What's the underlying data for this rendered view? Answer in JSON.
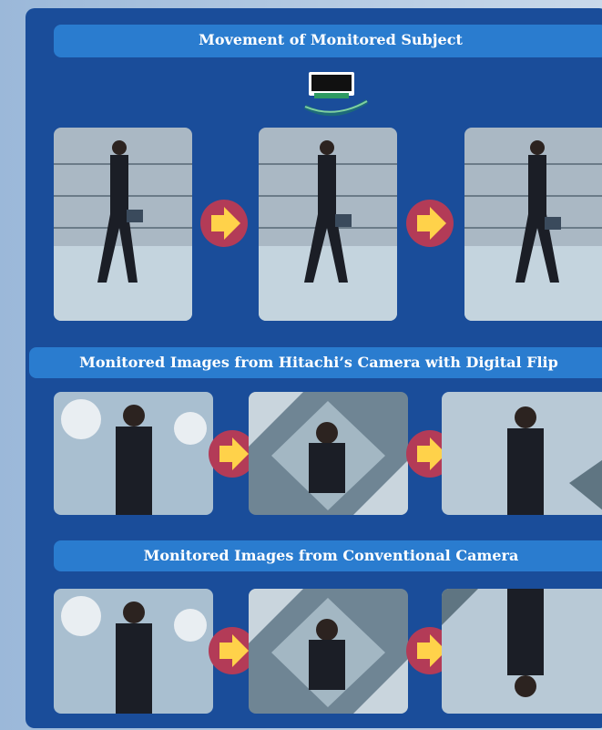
{
  "sections": [
    {
      "title": "Movement of Monitored Subject"
    },
    {
      "title": "Monitored Images from Hitachi’s Camera with Digital Flip"
    },
    {
      "title": "Monitored Images from Conventional Camera"
    }
  ],
  "icons": {
    "camera": "ceiling-camera-icon",
    "arrow": "right-arrow-icon",
    "motion": "curved-motion-arc-icon"
  },
  "colors": {
    "background": "#1a4d9a",
    "band": "#2a7ccf",
    "arrow_circle": "#b33b57",
    "arrow_fill": "#ffd24a",
    "camera_green": "#2e9a62"
  }
}
